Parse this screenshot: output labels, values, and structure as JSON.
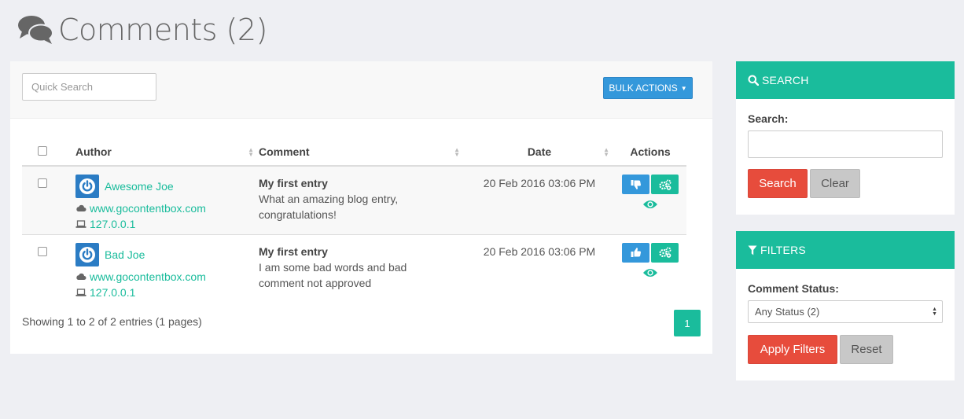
{
  "page": {
    "title": "Comments (2)",
    "icon": "comments-icon"
  },
  "toolbar": {
    "quick_search_placeholder": "Quick Search",
    "bulk_actions_label": "BULK ACTIONS"
  },
  "table": {
    "columns": [
      "Author",
      "Comment",
      "Date",
      "Actions"
    ],
    "rows": [
      {
        "author": "Awesome Joe",
        "website": "www.gocontentbox.com",
        "ip": "127.0.0.1",
        "comment_title": "My first entry",
        "comment_body_1": "What an amazing blog entry,",
        "comment_body_2": "congratulations!",
        "date": "20 Feb 2016 03:06 PM",
        "approve_icon": "thumbs-down-icon"
      },
      {
        "author": "Bad Joe",
        "website": "www.gocontentbox.com",
        "ip": "127.0.0.1",
        "comment_title": "My first entry",
        "comment_body_1": "I am some bad words and bad",
        "comment_body_2": "comment not approved",
        "date": "20 Feb 2016 03:06 PM",
        "approve_icon": "thumbs-up-icon"
      }
    ]
  },
  "pagination": {
    "info": "Showing 1 to 2 of 2 entries (1 pages)",
    "current_page": "1"
  },
  "search_panel": {
    "header": "SEARCH",
    "label": "Search:",
    "search_button": "Search",
    "clear_button": "Clear"
  },
  "filters_panel": {
    "header": "FILTERS",
    "label": "Comment Status:",
    "status_value": "Any Status (2)",
    "apply_button": "Apply Filters",
    "reset_button": "Reset"
  },
  "colors": {
    "accent": "#1abc9c",
    "primary": "#3498db",
    "danger": "#e74c3c",
    "avatar": "#2b7cc4"
  }
}
